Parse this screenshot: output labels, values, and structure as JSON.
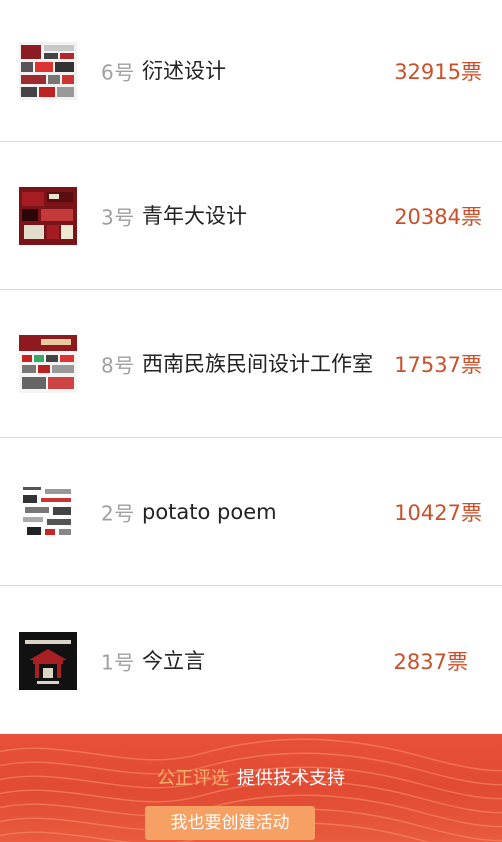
{
  "entries": [
    {
      "number": "6号",
      "name": "衍述设计",
      "votes": "32915票"
    },
    {
      "number": "3号",
      "name": "青年大设计",
      "votes": "20384票"
    },
    {
      "number": "8号",
      "name": "西南民族民间设计工作室",
      "votes": "17537票"
    },
    {
      "number": "2号",
      "name": "potato poem",
      "votes": "10427票"
    },
    {
      "number": "1号",
      "name": "今立言",
      "votes": "2837票"
    }
  ],
  "footer": {
    "brand": "公正评选",
    "support_text": "提供技术支持",
    "create_button": "我也要创建活动"
  },
  "colors": {
    "votes": "#c9502a",
    "footer_bg": "#e14a33",
    "button_bg": "#f6a064",
    "brand": "#f7b06e"
  }
}
